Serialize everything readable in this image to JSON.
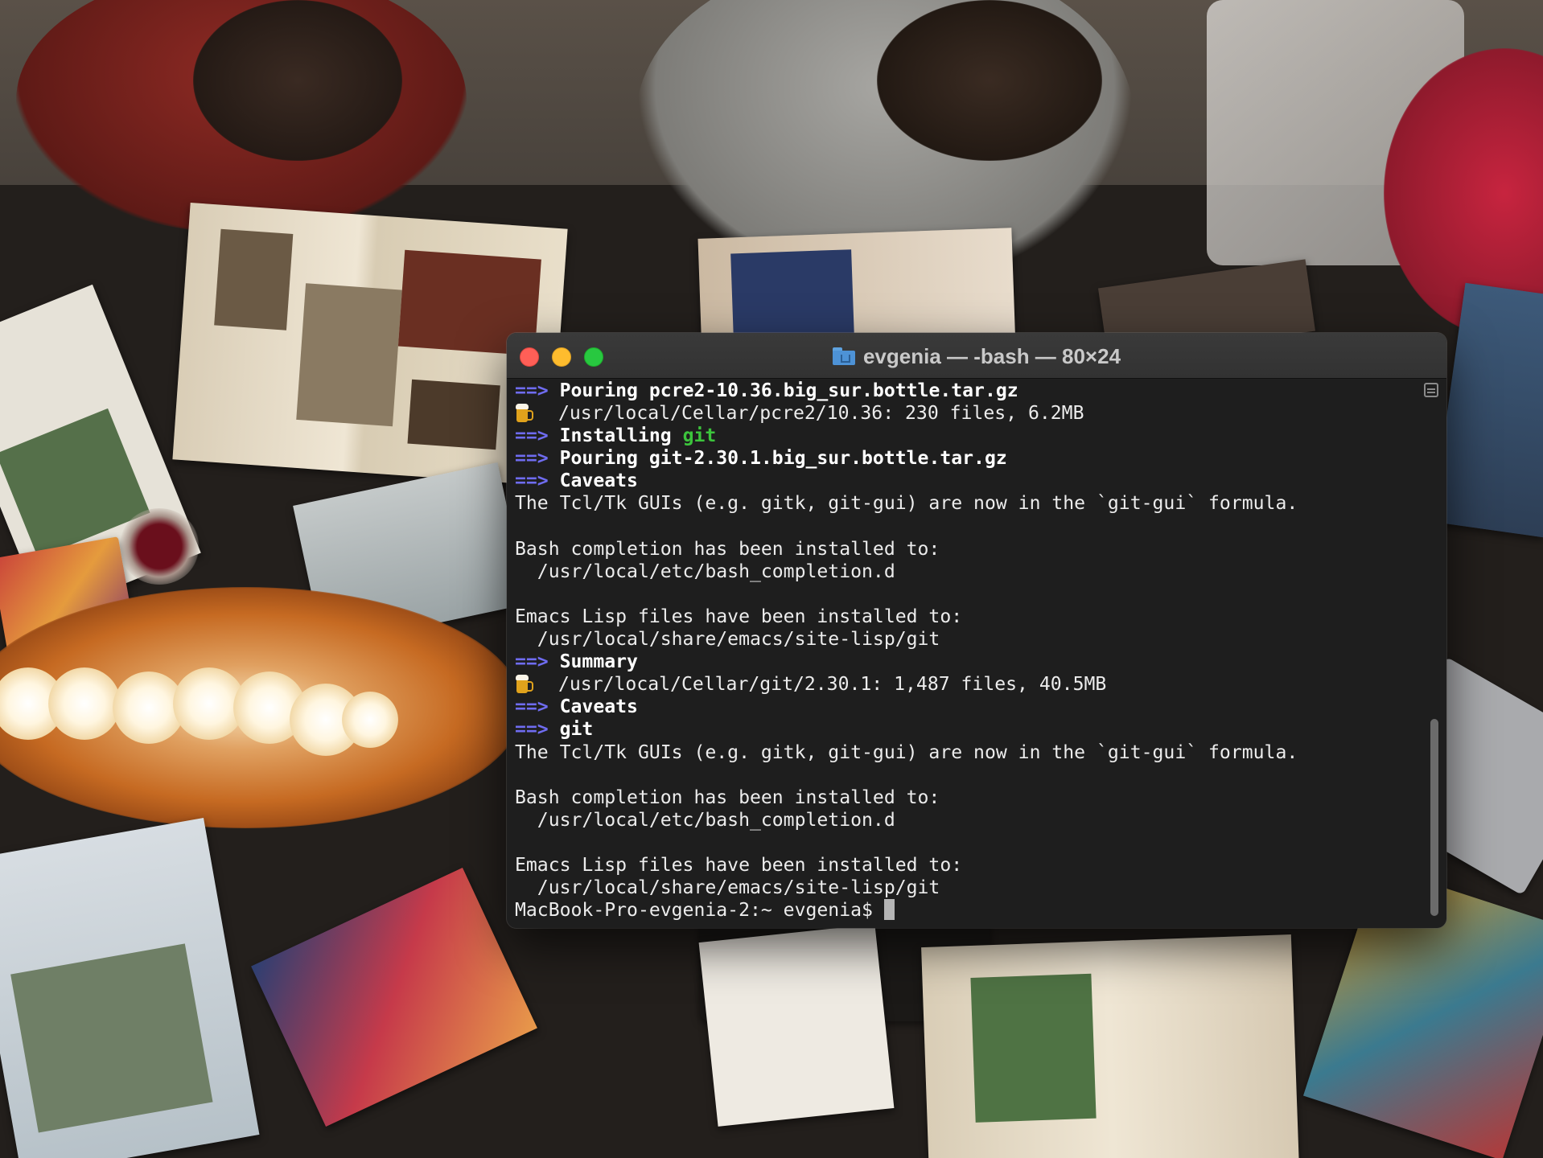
{
  "window": {
    "title": "evgenia — -bash — 80×24",
    "folder_icon": "home-folder-icon"
  },
  "colors": {
    "arrow": "#6f6cf0",
    "green": "#3cc43c",
    "terminal_bg": "#1e1e1e"
  },
  "terminal": {
    "lines": [
      {
        "arrow": "==>",
        "bold": "Pouring pcre2-10.36.big_sur.bottle.tar.gz"
      },
      {
        "icon": "beer-mug-icon",
        "text": "/usr/local/Cellar/pcre2/10.36: 230 files, 6.2MB"
      },
      {
        "arrow": "==>",
        "bold": "Installing",
        "green": "git"
      },
      {
        "arrow": "==>",
        "bold": "Pouring git-2.30.1.big_sur.bottle.tar.gz"
      },
      {
        "arrow": "==>",
        "bold": "Caveats"
      },
      {
        "text": "The Tcl/Tk GUIs (e.g. gitk, git-gui) are now in the `git-gui` formula."
      },
      {
        "text": ""
      },
      {
        "text": "Bash completion has been installed to:"
      },
      {
        "text": "  /usr/local/etc/bash_completion.d"
      },
      {
        "text": ""
      },
      {
        "text": "Emacs Lisp files have been installed to:"
      },
      {
        "text": "  /usr/local/share/emacs/site-lisp/git"
      },
      {
        "arrow": "==>",
        "bold": "Summary"
      },
      {
        "icon": "beer-mug-icon",
        "text": "/usr/local/Cellar/git/2.30.1: 1,487 files, 40.5MB"
      },
      {
        "arrow": "==>",
        "bold": "Caveats"
      },
      {
        "arrow": "==>",
        "bold": "git"
      },
      {
        "text": "The Tcl/Tk GUIs (e.g. gitk, git-gui) are now in the `git-gui` formula."
      },
      {
        "text": ""
      },
      {
        "text": "Bash completion has been installed to:"
      },
      {
        "text": "  /usr/local/etc/bash_completion.d"
      },
      {
        "text": ""
      },
      {
        "text": "Emacs Lisp files have been installed to:"
      },
      {
        "text": "  /usr/local/share/emacs/site-lisp/git"
      }
    ],
    "prompt": "MacBook-Pro-evgenia-2:~ evgenia$ "
  }
}
